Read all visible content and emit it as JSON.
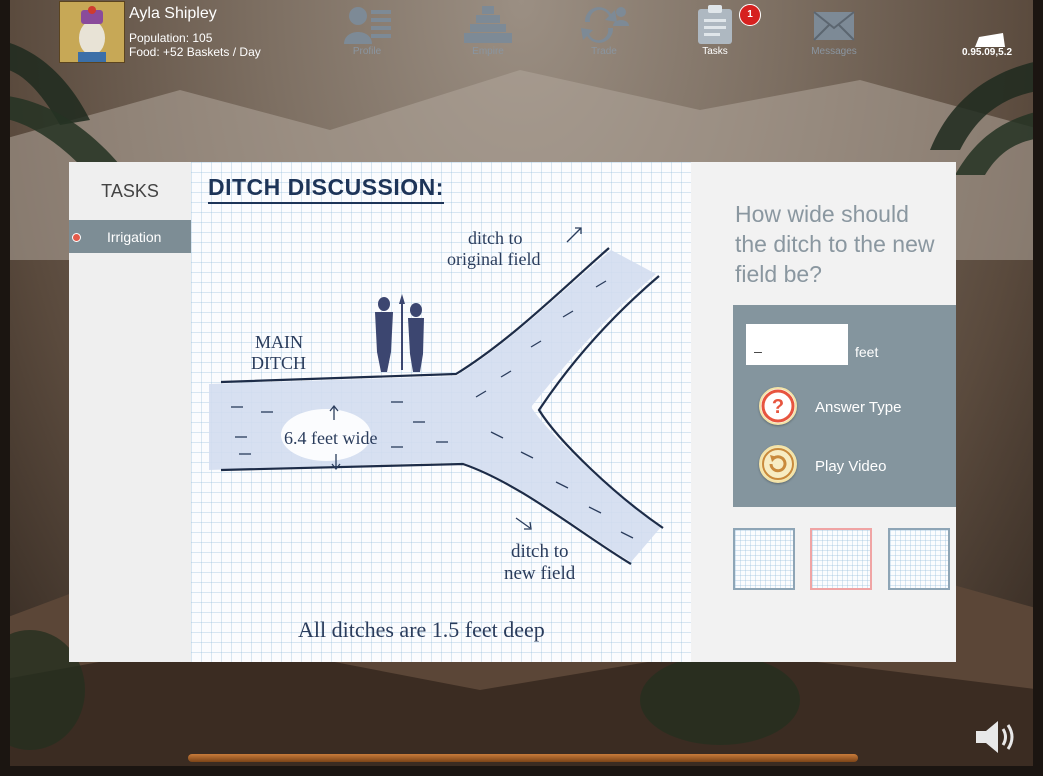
{
  "player": {
    "name": "Ayla Shipley",
    "population": "Population: 105",
    "food": "Food: +52 Baskets / Day"
  },
  "nav": {
    "profile": "Profile",
    "empire": "Empire",
    "trade": "Trade",
    "tasks": "Tasks",
    "messages": "Messages",
    "tasks_badge": "1"
  },
  "version": "0.95.09,5.2",
  "sidebar": {
    "title": "TASKS",
    "items": [
      {
        "label": "Irrigation"
      }
    ]
  },
  "sketch": {
    "title": "DITCH DISCUSSION:",
    "label_original_1": "ditch to",
    "label_original_2": "original field",
    "label_main_1": "MAIN",
    "label_main_2": "DITCH",
    "label_width": "6.4 feet wide",
    "label_new_1": "ditch to",
    "label_new_2": "new field",
    "caption": "All ditches are 1.5 feet deep"
  },
  "question": "How wide should the ditch to the new field be?",
  "answer": {
    "value": "_",
    "unit": "feet",
    "answer_type_label": "Answer Type",
    "play_video_label": "Play Video"
  },
  "colors": {
    "panel_bg": "#f2f2f2",
    "sidebar_selected": "#7d8d95",
    "answer_box": "#84959e",
    "question_text": "#8a97a0",
    "sketch_ink": "#1d3458",
    "help_icon": "#e7553f",
    "video_icon": "#c98a3c",
    "badge": "#d6211f"
  }
}
